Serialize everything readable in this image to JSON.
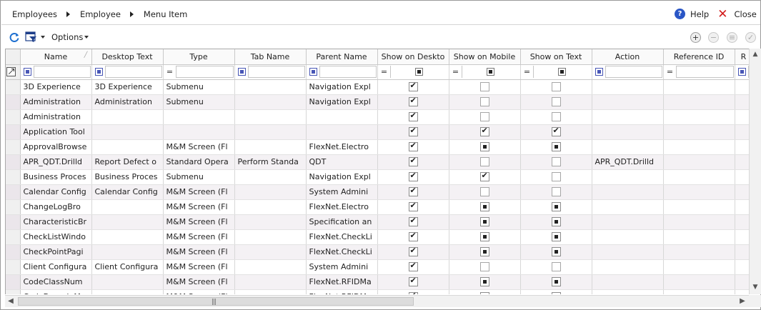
{
  "breadcrumb": [
    "Employees",
    "Employee",
    "Menu Item"
  ],
  "header": {
    "help_label": "Help",
    "close_label": "Close"
  },
  "toolbar": {
    "options_label": "Options"
  },
  "columns": [
    {
      "label": "Name",
      "filter": "square"
    },
    {
      "label": "Desktop Text",
      "filter": "square"
    },
    {
      "label": "Type",
      "filter": "equals"
    },
    {
      "label": "Tab Name",
      "filter": "square"
    },
    {
      "label": "Parent Name",
      "filter": "square"
    },
    {
      "label": "Show on Deskto",
      "filter": "equals-check"
    },
    {
      "label": "Show on Mobile",
      "filter": "equals-check"
    },
    {
      "label": "Show on Text",
      "filter": "equals-check"
    },
    {
      "label": "Action",
      "filter": "square"
    },
    {
      "label": "Reference ID",
      "filter": "equals"
    },
    {
      "label": "R",
      "filter": "square"
    }
  ],
  "rows": [
    {
      "name": "3D Experience",
      "desktop_text": "3D Experience",
      "type": "Submenu",
      "tab_name": "",
      "parent_name": "Navigation Expl",
      "desktop": "checked",
      "mobile": "none",
      "text": "none",
      "action": "",
      "reference_id": ""
    },
    {
      "name": "Administration",
      "desktop_text": "Administration",
      "type": "Submenu",
      "tab_name": "",
      "parent_name": "Navigation Expl",
      "desktop": "checked",
      "mobile": "none",
      "text": "none",
      "action": "",
      "reference_id": ""
    },
    {
      "name": "Administration",
      "desktop_text": "",
      "type": "",
      "tab_name": "",
      "parent_name": "",
      "desktop": "checked",
      "mobile": "none",
      "text": "none",
      "action": "",
      "reference_id": ""
    },
    {
      "name": "Application Tool",
      "desktop_text": "",
      "type": "",
      "tab_name": "",
      "parent_name": "",
      "desktop": "checked",
      "mobile": "checked",
      "text": "checked",
      "action": "",
      "reference_id": ""
    },
    {
      "name": "ApprovalBrowse",
      "desktop_text": "",
      "type": "M&M Screen (Fl",
      "tab_name": "",
      "parent_name": "FlexNet.Electro",
      "desktop": "checked",
      "mobile": "ind",
      "text": "ind",
      "action": "",
      "reference_id": ""
    },
    {
      "name": "APR_QDT.Drilld",
      "desktop_text": "Report Defect o",
      "type": "Standard Opera",
      "tab_name": "Perform Standa",
      "parent_name": "QDT",
      "desktop": "checked",
      "mobile": "none",
      "text": "none",
      "action": "APR_QDT.Drilld",
      "reference_id": ""
    },
    {
      "name": "Business Proces",
      "desktop_text": "Business Proces",
      "type": "Submenu",
      "tab_name": "",
      "parent_name": "Navigation Expl",
      "desktop": "checked",
      "mobile": "checked",
      "text": "none",
      "action": "",
      "reference_id": ""
    },
    {
      "name": "Calendar Config",
      "desktop_text": "Calendar Config",
      "type": "M&M Screen (Fl",
      "tab_name": "",
      "parent_name": "System Admini",
      "desktop": "checked",
      "mobile": "none",
      "text": "none",
      "action": "",
      "reference_id": ""
    },
    {
      "name": "ChangeLogBro",
      "desktop_text": "",
      "type": "M&M Screen (Fl",
      "tab_name": "",
      "parent_name": "FlexNet.Electro",
      "desktop": "checked",
      "mobile": "ind",
      "text": "ind",
      "action": "",
      "reference_id": ""
    },
    {
      "name": "CharacteristicBr",
      "desktop_text": "",
      "type": "M&M Screen (Fl",
      "tab_name": "",
      "parent_name": "Specification an",
      "desktop": "checked",
      "mobile": "ind",
      "text": "ind",
      "action": "",
      "reference_id": ""
    },
    {
      "name": "CheckListWindo",
      "desktop_text": "",
      "type": "M&M Screen (Fl",
      "tab_name": "",
      "parent_name": "FlexNet.CheckLi",
      "desktop": "checked",
      "mobile": "ind",
      "text": "ind",
      "action": "",
      "reference_id": ""
    },
    {
      "name": "CheckPointPagi",
      "desktop_text": "",
      "type": "M&M Screen (Fl",
      "tab_name": "",
      "parent_name": "FlexNet.CheckLi",
      "desktop": "checked",
      "mobile": "ind",
      "text": "ind",
      "action": "",
      "reference_id": ""
    },
    {
      "name": "Client Configura",
      "desktop_text": "Client Configura",
      "type": "M&M Screen (Fl",
      "tab_name": "",
      "parent_name": "System Admini",
      "desktop": "checked",
      "mobile": "none",
      "text": "none",
      "action": "",
      "reference_id": ""
    },
    {
      "name": "CodeClassNum",
      "desktop_text": "",
      "type": "M&M Screen (Fl",
      "tab_name": "",
      "parent_name": "FlexNet.RFIDMa",
      "desktop": "checked",
      "mobile": "ind",
      "text": "ind",
      "action": "",
      "reference_id": ""
    },
    {
      "name": "CodeDomainMa",
      "desktop_text": "",
      "type": "M&M Screen (Fl",
      "tab_name": "",
      "parent_name": "FlexNet.RFIDMa",
      "desktop": "checked",
      "mobile": "ind",
      "text": "ind",
      "action": "",
      "reference_id": ""
    }
  ]
}
